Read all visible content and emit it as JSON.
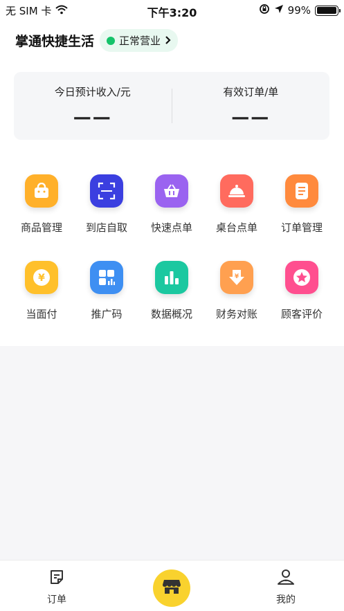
{
  "status_bar": {
    "carrier": "无 SIM 卡",
    "time": "下午3:20",
    "battery": "99%",
    "battery_level": 0.99
  },
  "header": {
    "store_name": "掌通快捷生活",
    "status": "正常营业"
  },
  "stats": {
    "income_label": "今日预计收入/元",
    "income_value": "——",
    "orders_label": "有效订单/单",
    "orders_value": "——"
  },
  "grid": {
    "items": [
      {
        "label": "商品管理",
        "icon": "shopping-bag-icon",
        "color": "#ffb02a"
      },
      {
        "label": "到店自取",
        "icon": "scan-icon",
        "color": "#3b3fe0"
      },
      {
        "label": "快速点单",
        "icon": "basket-icon",
        "color": "#9a63f0"
      },
      {
        "label": "桌台点单",
        "icon": "cloche-icon",
        "color": "#ff6b5e"
      },
      {
        "label": "订单管理",
        "icon": "document-icon",
        "color": "#ff8a3d"
      },
      {
        "label": "当面付",
        "icon": "yen-coin-icon",
        "color": "#ffc02b"
      },
      {
        "label": "推广码",
        "icon": "qr-code-icon",
        "color": "#3e8ff2"
      },
      {
        "label": "数据概况",
        "icon": "bar-chart-icon",
        "color": "#1cc8a0"
      },
      {
        "label": "财务对账",
        "icon": "yen-download-icon",
        "color": "#ffa050"
      },
      {
        "label": "顾客评价",
        "icon": "star-icon",
        "color": "#ff4f8f"
      }
    ]
  },
  "tabbar": {
    "orders_label": "订单",
    "me_label": "我的",
    "center_icon": "store-icon",
    "center_color": "#f9d22e"
  }
}
